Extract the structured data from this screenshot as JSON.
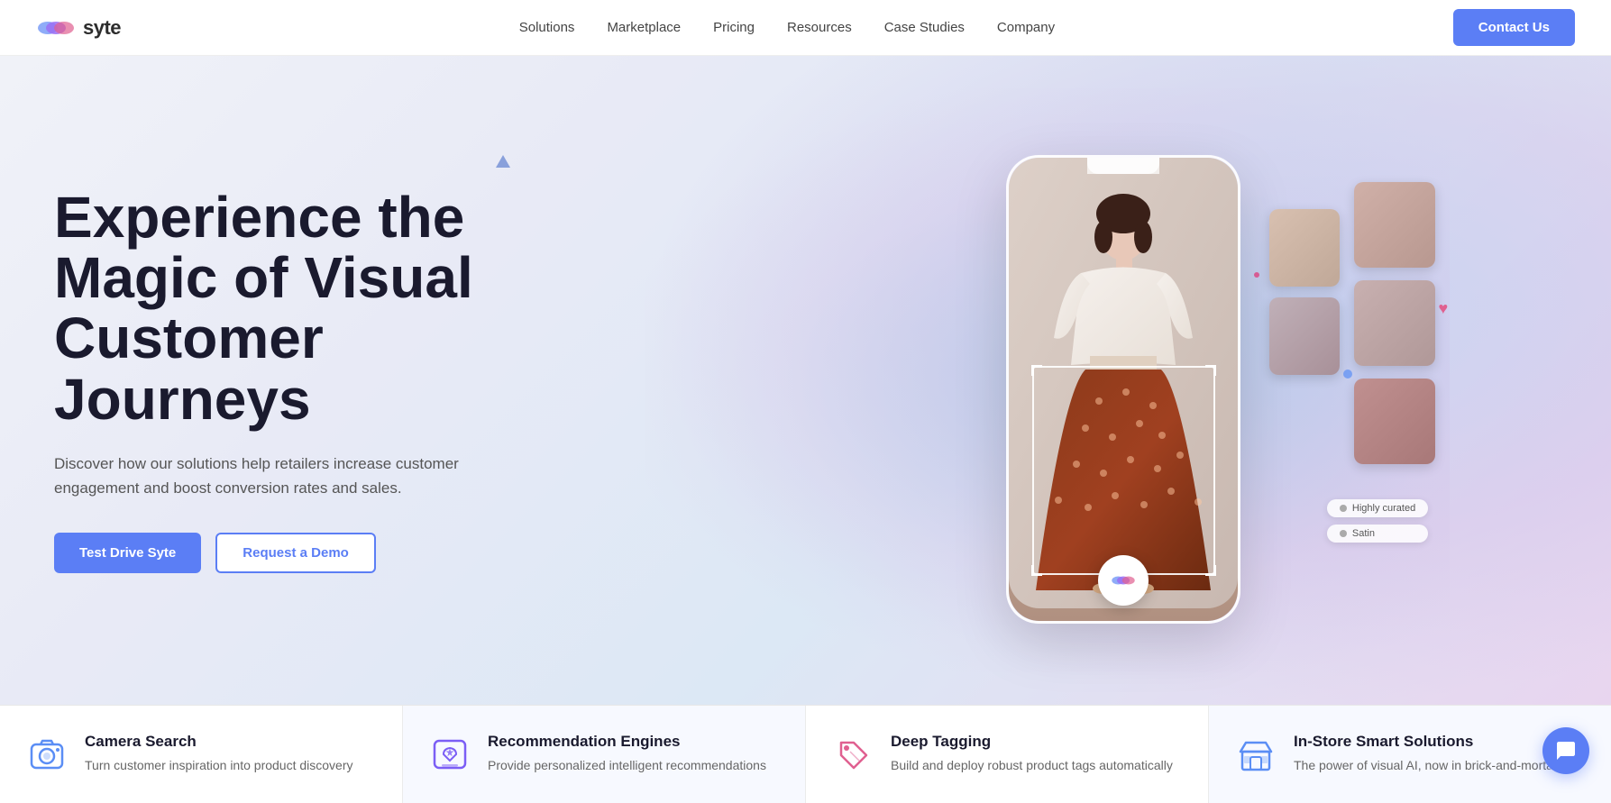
{
  "brand": {
    "name": "syte",
    "logo_text": "syte"
  },
  "nav": {
    "links": [
      {
        "label": "Solutions",
        "id": "solutions"
      },
      {
        "label": "Marketplace",
        "id": "marketplace"
      },
      {
        "label": "Pricing",
        "id": "pricing"
      },
      {
        "label": "Resources",
        "id": "resources"
      },
      {
        "label": "Case Studies",
        "id": "case-studies"
      },
      {
        "label": "Company",
        "id": "company"
      }
    ],
    "cta": "Contact Us"
  },
  "hero": {
    "title": "Experience the Magic of Visual Customer Journeys",
    "subtitle": "Discover how our solutions help retailers increase customer engagement and boost conversion rates and sales.",
    "btn_primary": "Test Drive Syte",
    "btn_secondary": "Request a Demo"
  },
  "cards": [
    {
      "id": "camera-search",
      "title": "Camera Search",
      "description": "Turn customer inspiration into product discovery",
      "icon": "camera"
    },
    {
      "id": "recommendation-engines",
      "title": "Recommendation Engines",
      "description": "Provide personalized intelligent recommendations",
      "icon": "star"
    },
    {
      "id": "deep-tagging",
      "title": "Deep Tagging",
      "description": "Build and deploy robust product tags automatically",
      "icon": "tag"
    },
    {
      "id": "in-store-smart",
      "title": "In-Store Smart Solutions",
      "description": "The power of visual AI, now in brick-and-mortar",
      "icon": "store"
    }
  ],
  "filter_pills": [
    {
      "label": "Highly curated"
    },
    {
      "label": "Satin"
    }
  ],
  "colors": {
    "primary": "#5b7ef5",
    "secondary": "#b06cf4",
    "accent_pink": "#e06090",
    "text_dark": "#1a1a2e",
    "text_mid": "#555555"
  }
}
